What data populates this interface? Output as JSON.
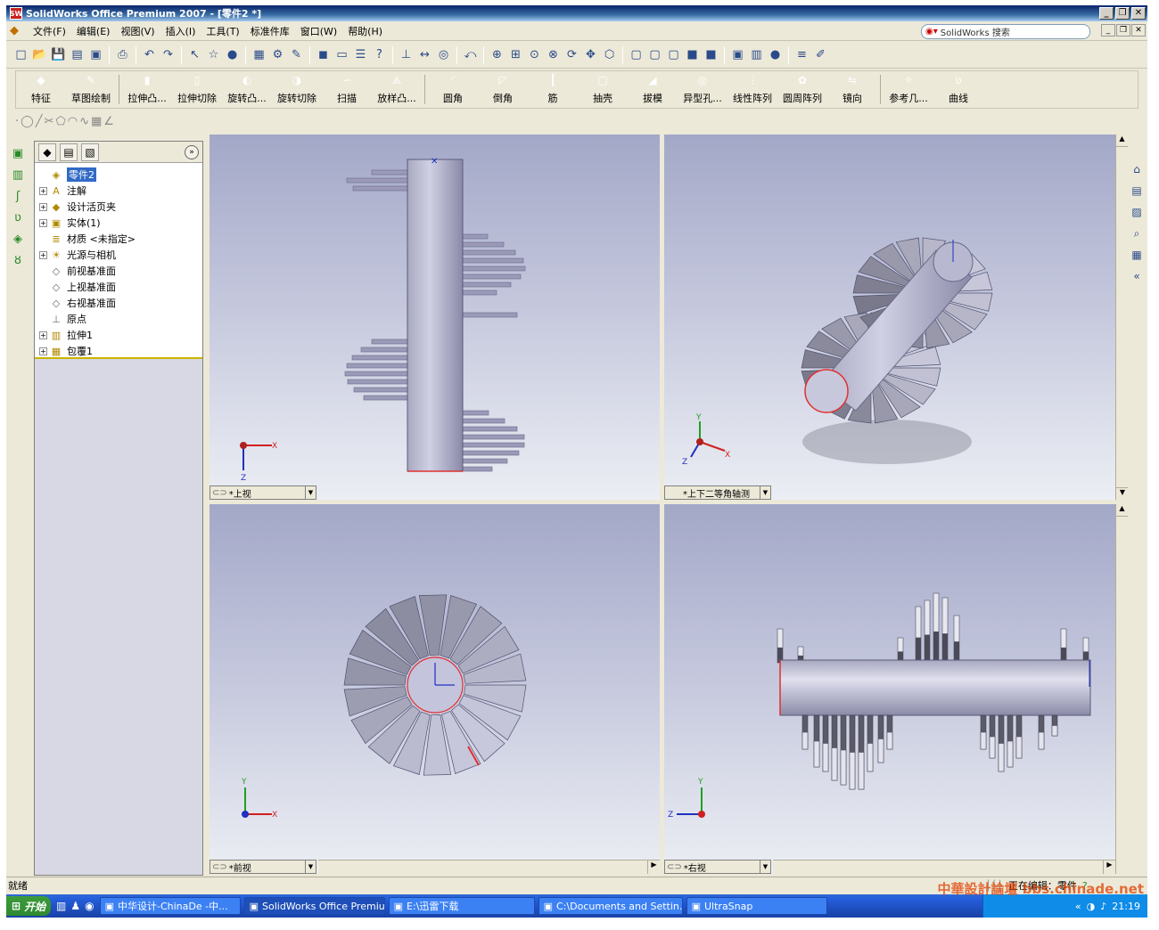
{
  "window": {
    "title": "SolidWorks Office Premium 2007 - [零件2 *]"
  },
  "menu": [
    "文件(F)",
    "编辑(E)",
    "视图(V)",
    "插入(I)",
    "工具(T)",
    "标准件库",
    "窗口(W)",
    "帮助(H)"
  ],
  "search": {
    "placeholder": "SolidWorks 搜索"
  },
  "command_manager": {
    "items": [
      {
        "label": "特征",
        "color": "#3a9a3a"
      },
      {
        "label": "草图绘制",
        "color": "#7a7a9a"
      },
      {
        "label": "拉伸凸...",
        "color": "#d8b800"
      },
      {
        "label": "拉伸切除",
        "color": "#d8b800"
      },
      {
        "label": "旋转凸...",
        "color": "#d8b800"
      },
      {
        "label": "旋转切除",
        "color": "#d8b800"
      },
      {
        "label": "扫描",
        "color": "#d8b800"
      },
      {
        "label": "放样凸...",
        "color": "#d8b800"
      },
      {
        "label": "圆角",
        "color": "#3a9a3a"
      },
      {
        "label": "倒角",
        "color": "#3a9a3a"
      },
      {
        "label": "筋",
        "color": "#3a9a3a"
      },
      {
        "label": "抽壳",
        "color": "#3a9a3a"
      },
      {
        "label": "拔模",
        "color": "#3a9a3a"
      },
      {
        "label": "异型孔...",
        "color": "#3a9a3a"
      },
      {
        "label": "线性阵列",
        "color": "#3a9a3a"
      },
      {
        "label": "圆周阵列",
        "color": "#3a9a3a"
      },
      {
        "label": "镜向",
        "color": "#3a9a3a"
      },
      {
        "label": "参考几...",
        "color": "#b8a000"
      },
      {
        "label": "曲线",
        "color": "#3a9a3a"
      }
    ]
  },
  "feature_tree": {
    "nodes": [
      {
        "label": "零件2",
        "expand": false,
        "icon": "part-icon"
      },
      {
        "label": "注解",
        "expand": true,
        "icon": "annotation-icon"
      },
      {
        "label": "设计活页夹",
        "expand": true,
        "icon": "design-binder-icon"
      },
      {
        "label": "实体(1)",
        "expand": true,
        "icon": "solid-body-icon"
      },
      {
        "label": "材质 <未指定>",
        "expand": false,
        "icon": "material-icon"
      },
      {
        "label": "光源与相机",
        "expand": true,
        "icon": "lights-icon"
      },
      {
        "label": "前视基准面",
        "expand": false,
        "icon": "plane-icon"
      },
      {
        "label": "上视基准面",
        "expand": false,
        "icon": "plane-icon"
      },
      {
        "label": "右视基准面",
        "expand": false,
        "icon": "plane-icon"
      },
      {
        "label": "原点",
        "expand": false,
        "icon": "origin-icon"
      },
      {
        "label": "拉伸1",
        "expand": true,
        "icon": "extrude-icon"
      },
      {
        "label": "包覆1",
        "expand": true,
        "icon": "wrap-icon"
      }
    ]
  },
  "viewports": {
    "top": "*上视",
    "iso": "*上下二等角轴测",
    "front": "*前视",
    "right": "*右视"
  },
  "axes": {
    "x": "X",
    "y": "Y",
    "z": "Z"
  },
  "status": {
    "left": "就绪",
    "editing": "正在编辑：零件"
  },
  "taskbar": {
    "start": "开始",
    "tasks": [
      {
        "label": "中华设计-ChinaDe -中...",
        "active": false
      },
      {
        "label": "SolidWorks Office Premiu...",
        "active": true
      },
      {
        "label": "E:\\迅雷下载",
        "active": false
      },
      {
        "label": "C:\\Documents and Settin...",
        "active": false
      },
      {
        "label": "UltraSnap",
        "active": false
      }
    ],
    "clock": "21:19"
  },
  "watermark": "中華設計論壇 bbs.chinade.net"
}
